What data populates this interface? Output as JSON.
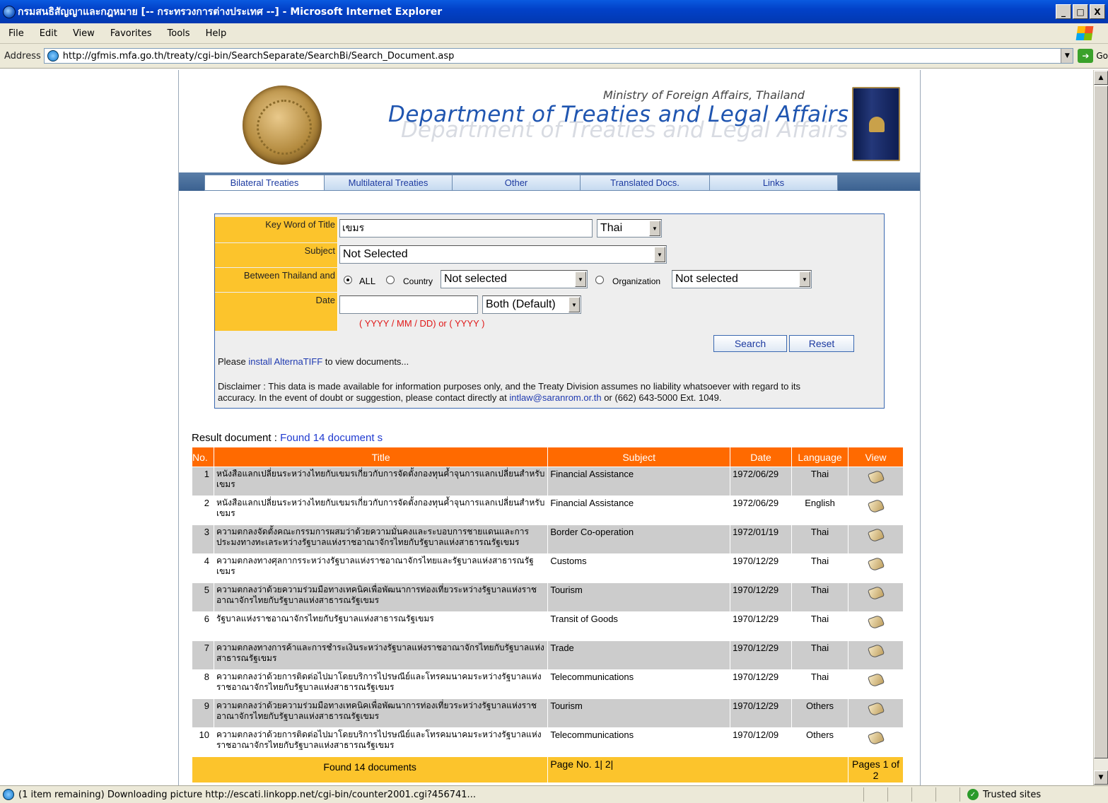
{
  "window": {
    "title": "กรมสนธิสัญญาและกฎหมาย [-- กระทรวงการต่างประเทศ --] - Microsoft Internet Explorer",
    "min": "_",
    "max": "□",
    "close": "X"
  },
  "menu": [
    "File",
    "Edit",
    "View",
    "Favorites",
    "Tools",
    "Help"
  ],
  "address": {
    "label": "Address",
    "url": "http://gfmis.mfa.go.th/treaty/cgi-bin/SearchSeparate/SearchBi/Search_Document.asp",
    "go": "Go"
  },
  "header": {
    "ministry": "Ministry of Foreign Affairs, Thailand",
    "department": "Department of Treaties and Legal Affairs"
  },
  "tabs": [
    "Bilateral Treaties",
    "Multilateral Treaties",
    "Other",
    "Translated Docs.",
    "Links"
  ],
  "form": {
    "keyword_label": "Key Word of Title",
    "keyword_value": "เขมร",
    "language_value": "Thai",
    "subject_label": "Subject",
    "subject_value": "Not Selected",
    "between_label": "Between Thailand and",
    "all_label": "ALL",
    "country_label": "Country",
    "country_value": "Not selected",
    "org_label": "Organization",
    "org_value": "Not selected",
    "date_label": "Date",
    "date_value": "",
    "date_mode": "Both (Default)",
    "date_hint": "( YYYY / MM / DD) or ( YYYY )",
    "search_btn": "Search",
    "reset_btn": "Reset",
    "install_pre": "Please",
    "install_link": "install AlternaTIFF",
    "install_post": "to view documents...",
    "disclaimer_1": "Disclaimer : This data is made available for information purposes only, and the Treaty Division assumes no liability whatsoever with regard to its",
    "disclaimer_2_pre": "accuracy. In the event of doubt or suggestion, please contact directly at",
    "disclaimer_email": "intlaw@saranrom.or.th",
    "disclaimer_2_post": "or (662) 643-5000 Ext. 1049."
  },
  "results": {
    "label": "Result document :",
    "found": "Found 14 document s",
    "headers": [
      "No.",
      "Title",
      "Subject",
      "Date",
      "Language",
      "View"
    ],
    "rows": [
      {
        "no": "1",
        "title": "หนังสือแลกเปลี่ยนระหว่างไทยกับเขมรเกี่ยวกับการจัดตั้งกองทุนค้ำจุนการแลกเปลี่ยนสำหรับเขมร",
        "subject": "Financial Assistance",
        "date": "1972/06/29",
        "language": "Thai"
      },
      {
        "no": "2",
        "title": "หนังสือแลกเปลี่ยนระหว่างไทยกับเขมรเกี่ยวกับการจัดตั้งกองทุนค้ำจุนการแลกเปลี่ยนสำหรับเขมร",
        "subject": "Financial Assistance",
        "date": "1972/06/29",
        "language": "English"
      },
      {
        "no": "3",
        "title": "ความตกลงจัดตั้งคณะกรรมการผสมว่าด้วยความมั่นคงและระบอบการชายแดนและการประมงทางทะเลระหว่างรัฐบาลแห่งราชอาณาจักรไทยกับรัฐบาลแห่งสาธารณรัฐเขมร",
        "subject": "Border Co-operation",
        "date": "1972/01/19",
        "language": "Thai"
      },
      {
        "no": "4",
        "title": "ความตกลงทางศุลกากรระหว่างรัฐบาลแห่งราชอาณาจักรไทยและรัฐบาลแห่งสาธารณรัฐเขมร",
        "subject": "Customs",
        "date": "1970/12/29",
        "language": "Thai"
      },
      {
        "no": "5",
        "title": "ความตกลงว่าด้วยความร่วมมือทางเทคนิคเพื่อพัฒนาการท่องเที่ยวระหว่างรัฐบาลแห่งราชอาณาจักรไทยกับรัฐบาลแห่งสาธารณรัฐเขมร",
        "subject": "Tourism",
        "date": "1970/12/29",
        "language": "Thai"
      },
      {
        "no": "6",
        "title": "รัฐบาลแห่งราชอาณาจักรไทยกับรัฐบาลแห่งสาธารณรัฐเขมร",
        "subject": "Transit of Goods",
        "date": "1970/12/29",
        "language": "Thai"
      },
      {
        "no": "7",
        "title": "ความตกลงทางการค้าและการชำระเงินระหว่างรัฐบาลแห่งราชอาณาจักรไทยกับรัฐบาลแห่งสาธารณรัฐเขมร",
        "subject": "Trade",
        "date": "1970/12/29",
        "language": "Thai"
      },
      {
        "no": "8",
        "title": "ความตกลงว่าด้วยการติดต่อไปมาโดยบริการไปรษณีย์และโทรคมนาคมระหว่างรัฐบาลแห่งราชอาณาจักรไทยกับรัฐบาลแห่งสาธารณรัฐเขมร",
        "subject": "Telecommunications",
        "date": "1970/12/29",
        "language": "Thai"
      },
      {
        "no": "9",
        "title": "ความตกลงว่าด้วยความร่วมมือทางเทคนิคเพื่อพัฒนาการท่องเที่ยวระหว่างรัฐบาลแห่งราชอาณาจักรไทยกับรัฐบาลแห่งสาธารณรัฐเขมร",
        "subject": "Tourism",
        "date": "1970/12/29",
        "language": "Others"
      },
      {
        "no": "10",
        "title": "ความตกลงว่าด้วยการติดต่อไปมาโดยบริการไปรษณีย์และโทรคมนาคมระหว่างรัฐบาลแห่งราชอาณาจักรไทยกับรัฐบาลแห่งสาธารณรัฐเขมร",
        "subject": "Telecommunications",
        "date": "1970/12/09",
        "language": "Others"
      }
    ],
    "footer_found": "Found 14 documents",
    "footer_pages_label": "Page No. 1| 2|",
    "footer_pages_of": "Pages 1 of 2"
  },
  "status": {
    "message": "(1 item remaining) Downloading picture http://escati.linkopp.net/cgi-bin/counter2001.cgi?456741...",
    "zone": "Trusted sites"
  }
}
